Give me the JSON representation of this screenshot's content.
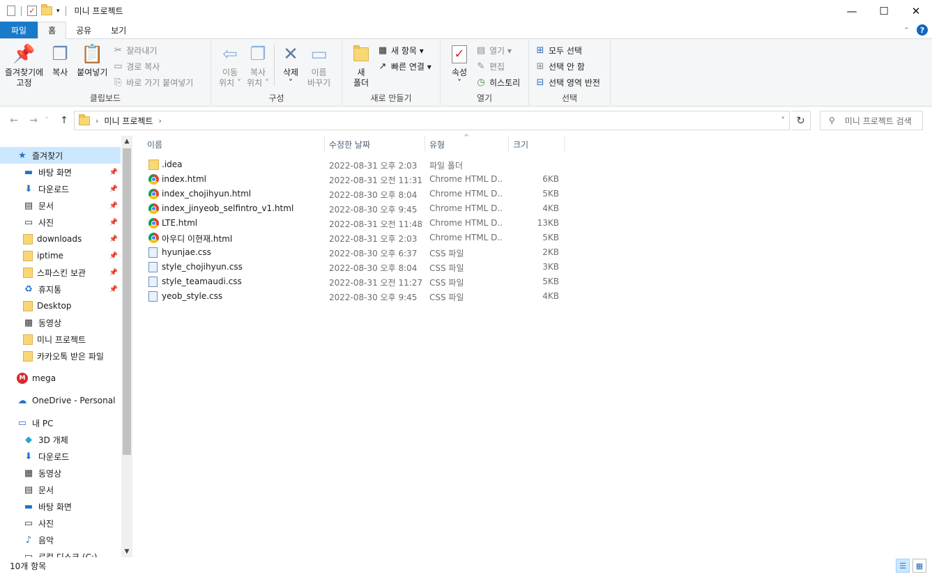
{
  "window": {
    "title": "미니 프로젝트",
    "controls": {
      "minimize": "—",
      "maximize": "☐",
      "close": "✕"
    }
  },
  "ribbon_tabs": [
    "파일",
    "홈",
    "공유",
    "보기"
  ],
  "ribbon": {
    "clipboard": {
      "label": "클립보드",
      "pin": "즐겨찾기에\n고정",
      "copy": "복사",
      "paste": "붙여넣기",
      "cut": "잘라내기",
      "copy_path": "경로 복사",
      "paste_shortcut": "바로 가기 붙여넣기"
    },
    "organize": {
      "label": "구성",
      "move_to": "이동\n위치 ˅",
      "copy_to": "복사\n위치 ˅",
      "delete": "삭제\n˅",
      "rename": "이름\n바꾸기"
    },
    "new": {
      "label": "새로 만들기",
      "new_folder": "새\n폴더",
      "new_item": "새 항목 ▾",
      "easy_access": "빠른 연결 ▾"
    },
    "open": {
      "label": "열기",
      "properties": "속성\n˅",
      "open": "열기 ▾",
      "edit": "편집",
      "history": "히스토리"
    },
    "select": {
      "label": "선택",
      "select_all": "모두 선택",
      "select_none": "선택 안 함",
      "invert": "선택 영역 반전"
    }
  },
  "address": {
    "path": "미니 프로젝트",
    "search_placeholder": "미니 프로젝트 검색"
  },
  "nav": [
    {
      "label": "즐겨찾기",
      "icon": "star-icon",
      "level": 1,
      "selected": true
    },
    {
      "label": "바탕 화면",
      "icon": "desktop-icon",
      "level": 2,
      "pinned": true
    },
    {
      "label": "다운로드",
      "icon": "download-icon",
      "level": 2,
      "pinned": true
    },
    {
      "label": "문서",
      "icon": "document-icon",
      "level": 2,
      "pinned": true
    },
    {
      "label": "사진",
      "icon": "pictures-icon",
      "level": 2,
      "pinned": true
    },
    {
      "label": "downloads",
      "icon": "folder-icon",
      "level": 2,
      "pinned": true
    },
    {
      "label": "iptime",
      "icon": "folder-icon",
      "level": 2,
      "pinned": true
    },
    {
      "label": "스파스킨 보관",
      "icon": "folder-icon",
      "level": 2,
      "pinned": true
    },
    {
      "label": "휴지통",
      "icon": "recycle-bin-icon",
      "level": 2,
      "pinned": true
    },
    {
      "label": "Desktop",
      "icon": "folder-icon",
      "level": 2
    },
    {
      "label": "동영상",
      "icon": "video-icon",
      "level": 2
    },
    {
      "label": "미니 프로젝트",
      "icon": "folder-icon",
      "level": 2
    },
    {
      "label": "카카오톡 받은 파일",
      "icon": "folder-icon",
      "level": 2
    },
    {
      "label": "mega",
      "icon": "mega-icon",
      "level": 1
    },
    {
      "label": "OneDrive - Personal",
      "icon": "onedrive-icon",
      "level": 1
    },
    {
      "label": "내 PC",
      "icon": "pc-icon",
      "level": 1
    },
    {
      "label": "3D 개체",
      "icon": "3d-objects-icon",
      "level": 2
    },
    {
      "label": "다운로드",
      "icon": "download-icon",
      "level": 2
    },
    {
      "label": "동영상",
      "icon": "video-icon",
      "level": 2
    },
    {
      "label": "문서",
      "icon": "document-icon",
      "level": 2
    },
    {
      "label": "바탕 화면",
      "icon": "desktop-icon",
      "level": 2
    },
    {
      "label": "사진",
      "icon": "pictures-icon",
      "level": 2
    },
    {
      "label": "음악",
      "icon": "music-icon",
      "level": 2
    },
    {
      "label": "로컬 디스크 (C:)",
      "icon": "drive-icon",
      "level": 2
    }
  ],
  "columns": [
    "이름",
    "수정한 날짜",
    "유형",
    "크기"
  ],
  "files": [
    {
      "name": ".idea",
      "date": "2022-08-31 오후 2:03",
      "type": "파일 폴더",
      "size": "",
      "icon": "folder"
    },
    {
      "name": "index.html",
      "date": "2022-08-31 오전 11:31",
      "type": "Chrome HTML D...",
      "size": "6KB",
      "icon": "chrome"
    },
    {
      "name": "index_chojihyun.html",
      "date": "2022-08-30 오후 8:04",
      "type": "Chrome HTML D...",
      "size": "5KB",
      "icon": "chrome"
    },
    {
      "name": "index_jinyeob_selfintro_v1.html",
      "date": "2022-08-30 오후 9:45",
      "type": "Chrome HTML D...",
      "size": "4KB",
      "icon": "chrome"
    },
    {
      "name": "LTE.html",
      "date": "2022-08-31 오전 11:48",
      "type": "Chrome HTML D...",
      "size": "13KB",
      "icon": "chrome"
    },
    {
      "name": "아우디 이현재.html",
      "date": "2022-08-31 오후 2:03",
      "type": "Chrome HTML D...",
      "size": "5KB",
      "icon": "chrome"
    },
    {
      "name": "hyunjae.css",
      "date": "2022-08-30 오후 6:37",
      "type": "CSS 파일",
      "size": "2KB",
      "icon": "css"
    },
    {
      "name": "style_chojihyun.css",
      "date": "2022-08-30 오후 8:04",
      "type": "CSS 파일",
      "size": "3KB",
      "icon": "css"
    },
    {
      "name": "style_teamaudi.css",
      "date": "2022-08-31 오전 11:27",
      "type": "CSS 파일",
      "size": "5KB",
      "icon": "css"
    },
    {
      "name": "yeob_style.css",
      "date": "2022-08-30 오후 9:45",
      "type": "CSS 파일",
      "size": "4KB",
      "icon": "css"
    }
  ],
  "status": {
    "count": "10개 항목"
  }
}
